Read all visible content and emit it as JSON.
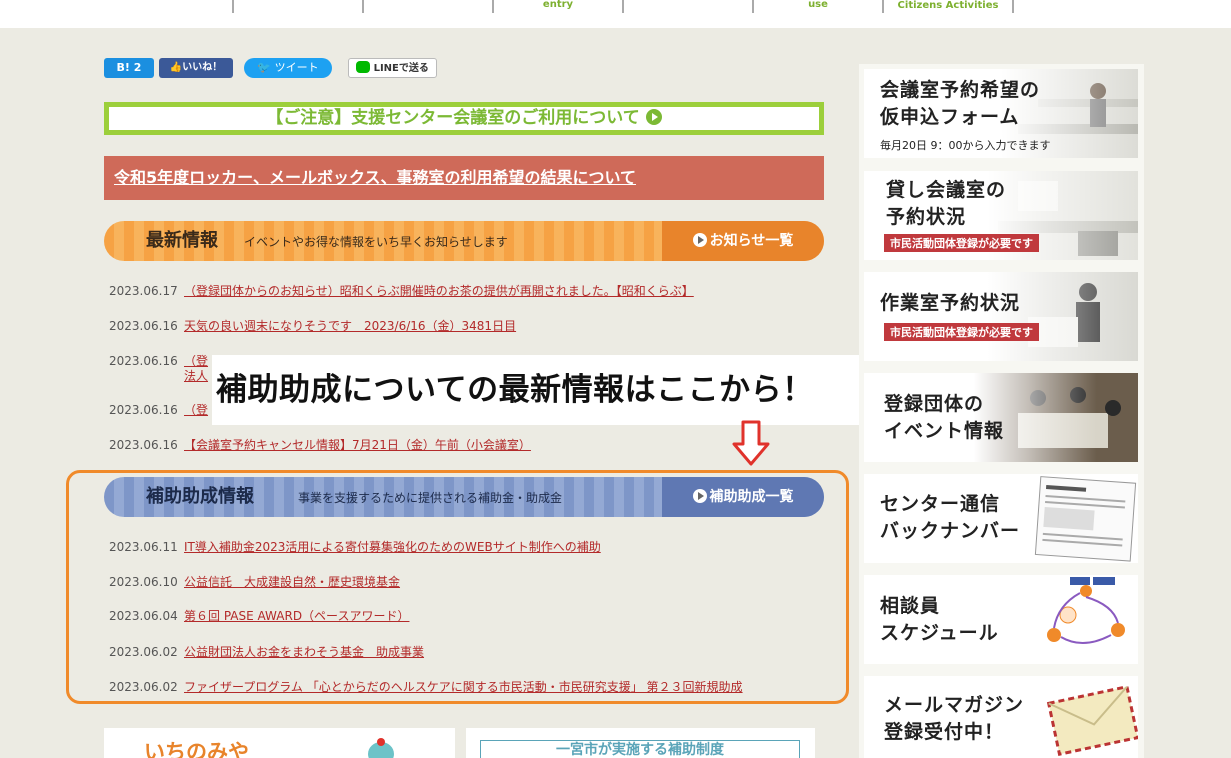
{
  "topnav": {
    "items": [
      "",
      "",
      "entry",
      "",
      "use",
      "Citizens Activities",
      ""
    ]
  },
  "social": {
    "hatena": "B! 2",
    "facebook": "いいね！",
    "twitter": "ツイート",
    "line": "LINEで送る"
  },
  "notices": {
    "green": "【ご注意】支援センター会議室のご利用について",
    "red": "令和5年度ロッカー、メールボックス、事務室の利用希望の結果について"
  },
  "latest": {
    "title": "最新情報",
    "subtitle": "イベントやお得な情報をいち早くお知らせします",
    "more": "お知らせ一覧",
    "rows": [
      {
        "date": "2023.06.17",
        "text": "（登録団体からのお知らせ）昭和くらぶ開催時のお茶の提供が再開されました。【昭和くらぶ】"
      },
      {
        "date": "2023.06.16",
        "text": "天気の良い週末になりそうです　2023/6/16（金）3481日目"
      },
      {
        "date": "2023.06.16",
        "text": "（登"
      },
      {
        "date": "",
        "text": "法人"
      },
      {
        "date": "2023.06.16",
        "text": "（登"
      },
      {
        "date": "2023.06.16",
        "text": "【会議室予約キャンセル情報】7月21日（金）午前（小会議室）"
      }
    ]
  },
  "callout": "補助助成についての最新情報はここから！",
  "grants": {
    "title": "補助助成情報",
    "subtitle": "事業を支援するために提供される補助金・助成金",
    "more": "補助助成一覧",
    "rows": [
      {
        "date": "2023.06.11",
        "text": "IT導入補助金2023活用による寄付募集強化のためのWEBサイト制作への補助"
      },
      {
        "date": "2023.06.10",
        "text": "公益信託　大成建設自然・歴史環境基金"
      },
      {
        "date": "2023.06.04",
        "text": "第６回 PASE AWARD（ペースアワード）"
      },
      {
        "date": "2023.06.02",
        "text": "公益財団法人お金をまわそう基金　助成事業"
      },
      {
        "date": "2023.06.02",
        "text": "ファイザープログラム 「心とからだのヘルスケアに関する市民活動・市民研究支援」 第２３回新規助成"
      }
    ]
  },
  "sidebar": {
    "banners": [
      {
        "title": "会議室予約希望の\n仮申込フォーム",
        "note": "毎月20日 9：00から入力できます",
        "tag": ""
      },
      {
        "title": "貸し会議室の\n予約状況",
        "note": "",
        "tag": "市民活動団体登録が必要です"
      },
      {
        "title": "作業室予約状況",
        "note": "",
        "tag": "市民活動団体登録が必要です"
      },
      {
        "title": "登録団体の\nイベント情報",
        "note": "",
        "tag": ""
      },
      {
        "title": "センター通信\nバックナンバー",
        "note": "",
        "tag": ""
      },
      {
        "title": "相談員\nスケジュール",
        "note": "",
        "tag": ""
      },
      {
        "title": "メールマガジン\n登録受付中！",
        "note": "",
        "tag": ""
      }
    ]
  },
  "bottom": {
    "left": "いちのみや",
    "right": "一宮市が実施する補助制度"
  },
  "colors": {
    "accent_green": "#9ccf3b",
    "accent_red": "#cf6a59",
    "accent_orange": "#f08a2a",
    "accent_blue": "#5f78b3",
    "link": "#b32a2a"
  }
}
